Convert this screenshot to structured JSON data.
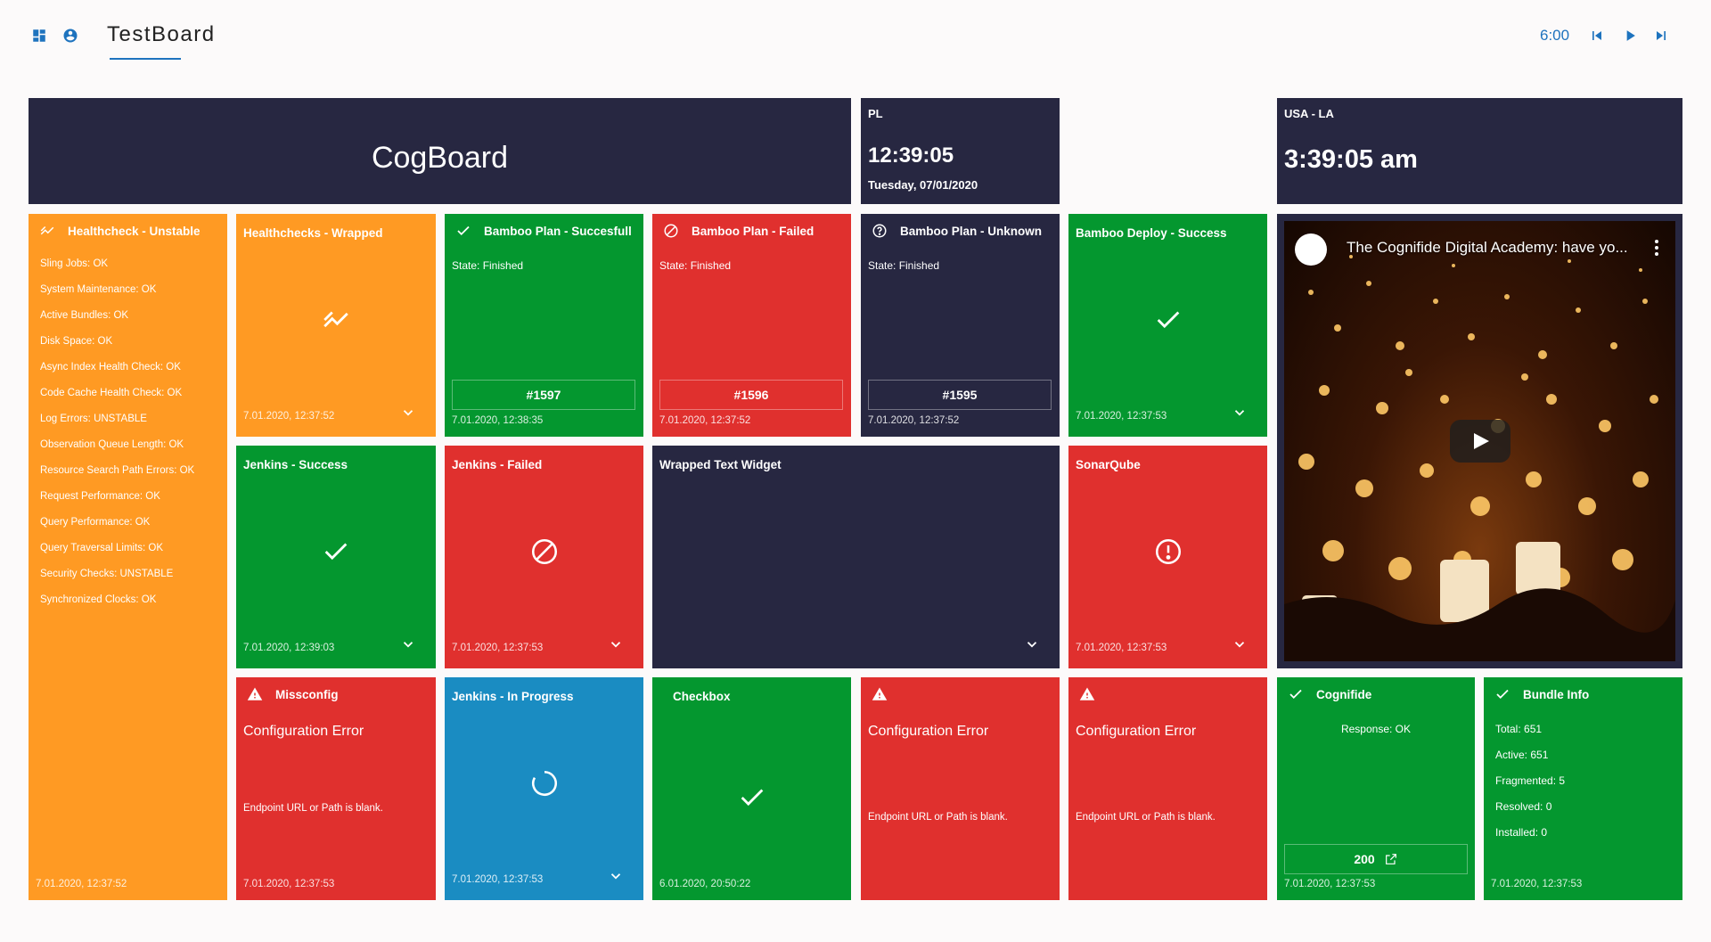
{
  "header": {
    "title": "TestBoard",
    "timer": "6:00",
    "accent_color": "#1e73be",
    "icons": [
      "dashboard-icon",
      "account-circle-icon",
      "skip-previous-icon",
      "play-icon",
      "skip-next-icon"
    ]
  },
  "colors": {
    "navy": "#272741",
    "orange": "#ff9a23",
    "green": "#04972f",
    "red": "#e0302e",
    "blue": "#1a8cc2",
    "background": "#fcfafa"
  },
  "cogboard": {
    "text": "CogBoard"
  },
  "clock_pl": {
    "location": "PL",
    "time": "12:39:05",
    "date": "Tuesday, 07/01/2020"
  },
  "clock_la": {
    "location": "USA - LA",
    "time": "3:39:05 am"
  },
  "healthcheck": {
    "title": "Healthcheck - Unstable",
    "items": [
      "Sling Jobs: OK",
      "System Maintenance: OK",
      "Active Bundles: OK",
      "Disk Space: OK",
      "Async Index Health Check: OK",
      "Code Cache Health Check: OK",
      "Log Errors: UNSTABLE",
      "Observation Queue Length: OK",
      "Resource Search Path Errors: OK",
      "Request Performance: OK",
      "Query Performance: OK",
      "Query Traversal Limits: OK",
      "Security Checks: UNSTABLE",
      "Synchronized Clocks: OK"
    ],
    "timestamp": "7.01.2020, 12:37:52"
  },
  "healthchecks_wrapped": {
    "title": "Healthchecks - Wrapped",
    "timestamp": "7.01.2020, 12:37:52"
  },
  "bamboo_success": {
    "title": "Bamboo Plan - Succesfull",
    "state": "State: Finished",
    "build": "#1597",
    "timestamp": "7.01.2020, 12:38:35"
  },
  "bamboo_failed": {
    "title": "Bamboo Plan - Failed",
    "state": "State: Finished",
    "build": "#1596",
    "timestamp": "7.01.2020, 12:37:52"
  },
  "bamboo_unknown": {
    "title": "Bamboo Plan - Unknown",
    "state": "State: Finished",
    "build": "#1595",
    "timestamp": "7.01.2020, 12:37:52"
  },
  "bamboo_deploy": {
    "title": "Bamboo Deploy - Success",
    "timestamp": "7.01.2020, 12:37:53"
  },
  "video": {
    "title": "The Cognifide Digital Academy: have yo..."
  },
  "jenkins_success": {
    "title": "Jenkins - Success",
    "timestamp": "7.01.2020, 12:39:03"
  },
  "jenkins_failed": {
    "title": "Jenkins - Failed",
    "timestamp": "7.01.2020, 12:37:53"
  },
  "wrapped_text": {
    "title": "Wrapped Text Widget"
  },
  "sonarqube": {
    "title": "SonarQube",
    "timestamp": "7.01.2020, 12:37:53"
  },
  "missconfig": {
    "title": "Missconfig",
    "heading": "Configuration Error",
    "message": "Endpoint URL or Path is blank.",
    "timestamp": "7.01.2020, 12:37:53"
  },
  "jenkins_progress": {
    "title": "Jenkins - In Progress",
    "timestamp": "7.01.2020, 12:37:53"
  },
  "checkbox": {
    "title": "Checkbox",
    "timestamp": "6.01.2020, 20:50:22"
  },
  "config_error_1": {
    "heading": "Configuration Error",
    "message": "Endpoint URL or Path is blank."
  },
  "config_error_2": {
    "heading": "Configuration Error",
    "message": "Endpoint URL or Path is blank."
  },
  "cognifide": {
    "title": "Cognifide",
    "response": "Response: OK",
    "status_code": "200",
    "timestamp": "7.01.2020, 12:37:53"
  },
  "bundle_info": {
    "title": "Bundle Info",
    "total": "Total: 651",
    "active": "Active: 651",
    "fragmented": "Fragmented: 5",
    "resolved": "Resolved: 0",
    "installed": "Installed: 0",
    "timestamp": "7.01.2020, 12:37:53"
  }
}
